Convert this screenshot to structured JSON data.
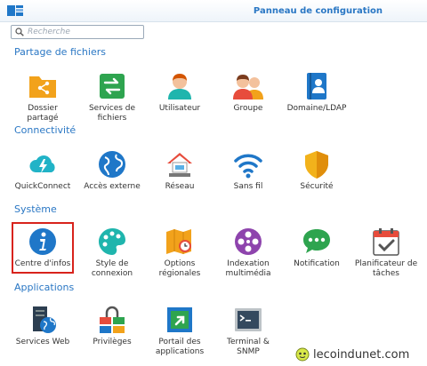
{
  "window": {
    "title": "Panneau de configuration"
  },
  "search": {
    "placeholder": "Recherche"
  },
  "sections": [
    {
      "title": "Partage de fichiers",
      "items": [
        {
          "label": "Dossier\npartagé",
          "icon": "shared-folder-icon",
          "color": "#f2a21b"
        },
        {
          "label": "Services de\nfichiers",
          "icon": "file-services-icon",
          "color": "#2ea44f"
        },
        {
          "label": "Utilisateur",
          "icon": "user-icon",
          "color": "#e67e22"
        },
        {
          "label": "Groupe",
          "icon": "group-icon",
          "color": "#e74c3c"
        },
        {
          "label": "Domaine/LDAP",
          "icon": "domain-ldap-icon",
          "color": "#2a77c4"
        }
      ]
    },
    {
      "title": "Connectivité",
      "items": [
        {
          "label": "QuickConnect",
          "icon": "quickconnect-icon",
          "color": "#21b3c7"
        },
        {
          "label": "Accès externe",
          "icon": "external-access-icon",
          "color": "#1f77c8"
        },
        {
          "label": "Réseau",
          "icon": "network-icon",
          "color": "#e74c3c"
        },
        {
          "label": "Sans fil",
          "icon": "wireless-icon",
          "color": "#1f77c8"
        },
        {
          "label": "Sécurité",
          "icon": "security-shield-icon",
          "color": "#f2b21b"
        }
      ]
    },
    {
      "title": "Système",
      "items": [
        {
          "label": "Centre d'infos",
          "icon": "info-center-icon",
          "color": "#1f77c8"
        },
        {
          "label": "Style de\nconnexion",
          "icon": "palette-icon",
          "color": "#1fb5ad"
        },
        {
          "label": "Options\nrégionales",
          "icon": "regional-options-icon",
          "color": "#f2a21b"
        },
        {
          "label": "Indexation\nmultimédia",
          "icon": "media-indexing-icon",
          "color": "#8e44ad"
        },
        {
          "label": "Notification",
          "icon": "notification-icon",
          "color": "#2ea44f"
        },
        {
          "label": "Planificateur de\ntâches",
          "icon": "task-scheduler-icon",
          "color": "#e74c3c"
        }
      ]
    },
    {
      "title": "Applications",
      "items": [
        {
          "label": "Services Web",
          "icon": "web-services-icon",
          "color": "#2c3e50"
        },
        {
          "label": "Privilèges",
          "icon": "privileges-icon",
          "color": "#e74c3c"
        },
        {
          "label": "Portail des\napplications",
          "icon": "application-portal-icon",
          "color": "#2ea44f"
        },
        {
          "label": "Terminal &\nSNMP",
          "icon": "terminal-snmp-icon",
          "color": "#34495e"
        }
      ]
    }
  ],
  "watermark": {
    "text": "lecoindunet.com"
  }
}
